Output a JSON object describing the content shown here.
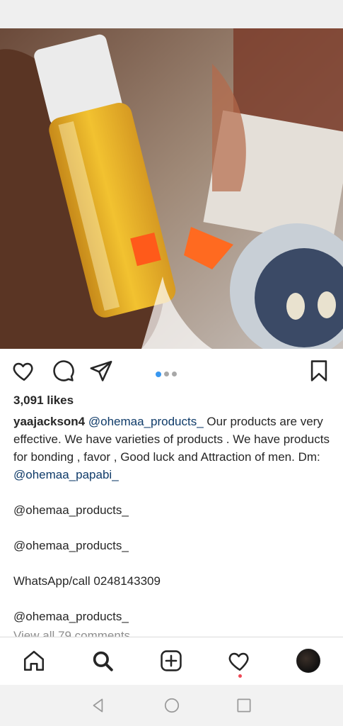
{
  "post": {
    "likes": "3,091 likes",
    "username": "yaajackson4",
    "caption_mention": "@ohemaa_products_",
    "caption_text": "  Our products are very effective. We have varieties of products . We have products for bonding , favor , Good luck and Attraction of men.  Dm: ",
    "caption_dm_mention": "@ohemaa_papabi_",
    "mention_line_1": "@ohemaa_products_",
    "mention_line_2": "@ohemaa_products_",
    "whatsapp": "WhatsApp/call 0248143309",
    "mention_line_3": "@ohemaa_products_",
    "view_comments": "View all 79 comments",
    "carousel": {
      "total": 3,
      "active_index": 0
    }
  },
  "icons": {
    "like": "heart-outline-icon",
    "comment": "comment-bubble-icon",
    "share": "paper-plane-icon",
    "save": "bookmark-icon"
  },
  "bottom_nav": [
    "home-icon",
    "search-icon",
    "add-post-icon",
    "activity-heart-icon",
    "profile-avatar"
  ],
  "colors": {
    "mention": "#0f3b69",
    "active_dot": "#3897f0",
    "notification_dot": "#ed4956"
  }
}
